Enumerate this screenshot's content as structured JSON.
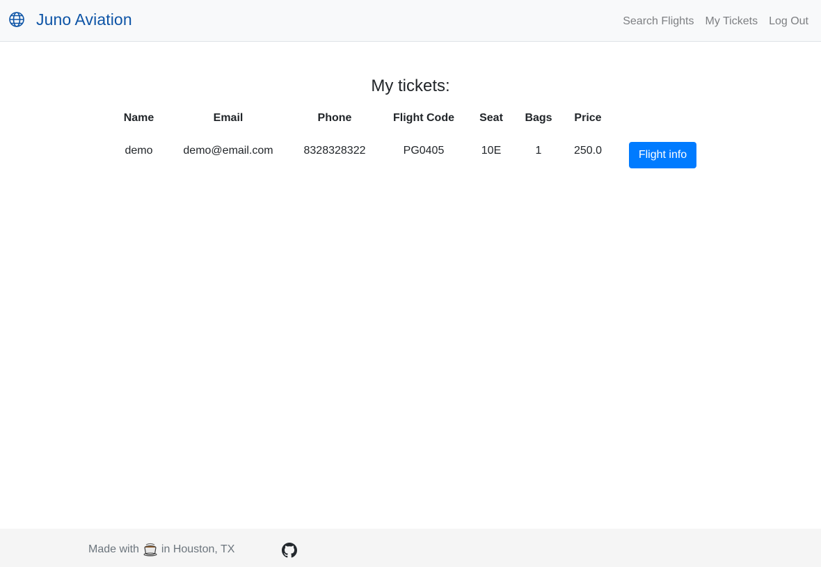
{
  "navbar": {
    "brand": "Juno Aviation",
    "brand_icon": "globe-icon",
    "brand_color": "#0d54a6",
    "links": [
      "Search Flights",
      "My Tickets",
      "Log Out"
    ]
  },
  "main": {
    "title": "My tickets:",
    "table": {
      "headers": [
        "Name",
        "Email",
        "Phone",
        "Flight Code",
        "Seat",
        "Bags",
        "Price"
      ],
      "rows": [
        {
          "cells": [
            "demo",
            "demo@email.com",
            "8328328322",
            "PG0405",
            "10E",
            "1",
            "250.0"
          ],
          "action_label": "Flight info"
        }
      ]
    },
    "button_color": "#007bff"
  },
  "footer": {
    "made_with": "Made with",
    "location": "in Houston, TX",
    "coffee_icon": "coffee-icon",
    "github_icon": "github-icon"
  }
}
